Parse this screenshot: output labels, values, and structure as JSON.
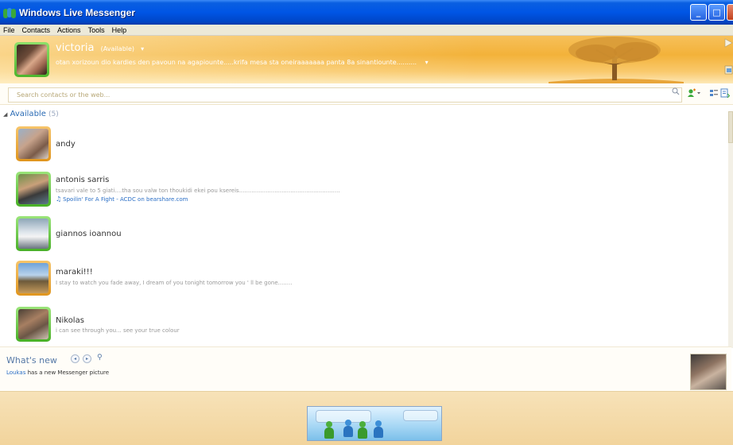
{
  "window": {
    "title": "Windows Live Messenger",
    "buttons": [
      "_",
      "□",
      "X"
    ]
  },
  "menu": [
    "File",
    "Contacts",
    "Actions",
    "Tools",
    "Help"
  ],
  "profile": {
    "name": "victoria",
    "status": "(Available)",
    "status_arrow": "▾",
    "personal_message": "otan xorizoun dio kardies den pavoun na agapiounte.....krifa mesa sta oneiraaaaaaa panta 8a sinantiounte..........",
    "psm_arrow": "▾"
  },
  "search": {
    "placeholder": "Search contacts or the web..."
  },
  "group": {
    "name": "Available",
    "count": "(5)",
    "arrow": "◢"
  },
  "contacts": [
    {
      "name": "andy",
      "psm": "",
      "music": "",
      "frame": "orange"
    },
    {
      "name": "antonis sarris",
      "psm": "tsavari vale to 5 giati....tha sou valw ton thoukidi ekei pou ksereis.........................................................",
      "music": "Spoilin' For A Fight - ACDC on bearshare.com",
      "frame": "green"
    },
    {
      "name": "giannos ioannou",
      "psm": "",
      "music": "",
      "frame": "green"
    },
    {
      "name": "maraki!!!",
      "psm": "I stay to watch you fade away, I dream of you tonight tomorrow you ' ll be gone........",
      "music": "",
      "frame": "orange"
    },
    {
      "name": "Nikolas",
      "psm": "i can see through you... see your true colour",
      "music": "",
      "frame": "green"
    }
  ],
  "whats_new": {
    "title": "What's new",
    "prev": "◂",
    "next": "▸",
    "search_icon": "⚲",
    "item_link": "Loukas",
    "item_text": " has a new Messenger picture"
  },
  "icons": {
    "music_note": "♫",
    "search": "⌕"
  },
  "colors": {
    "titlebar": "#0055e5",
    "header": "#f3b23a",
    "link": "#2b6fc6",
    "available_frame": "#48b026",
    "idle_frame": "#e0951d"
  }
}
